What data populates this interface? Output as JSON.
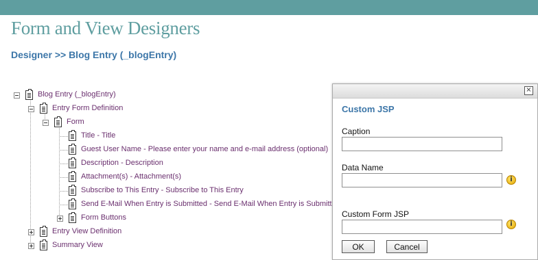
{
  "header": {
    "title": "Form and View Designers",
    "breadcrumb": {
      "designer": "Designer",
      "separator": ">>",
      "current": "Blog Entry (_blogEntry)"
    }
  },
  "tree": {
    "nodes": [
      {
        "label": "Blog Entry (_blogEntry)",
        "expanded": true
      },
      {
        "label": "Entry Form Definition",
        "expanded": true
      },
      {
        "label": "Form",
        "expanded": true
      },
      {
        "label": "Title - Title"
      },
      {
        "label": "Guest User Name - Please enter your name and e-mail address (optional)"
      },
      {
        "label": "Description - Description"
      },
      {
        "label": "Attachment(s) - Attachment(s)"
      },
      {
        "label": "Subscribe to This Entry - Subscribe to This Entry"
      },
      {
        "label": "Send E-Mail When Entry is Submitted - Send E-Mail When Entry is Submitted"
      },
      {
        "label": "Form Buttons",
        "expanded": false
      },
      {
        "label": "Entry View Definition",
        "expanded": false
      },
      {
        "label": "Summary View",
        "expanded": false
      }
    ]
  },
  "dialog": {
    "close_glyph": "×",
    "heading": "Custom JSP",
    "caption_label": "Caption",
    "caption_value": "",
    "data_name_label": "Data Name",
    "data_name_value": "",
    "custom_jsp_label": "Custom Form JSP",
    "custom_jsp_value": "",
    "info_glyph": "i",
    "ok_label": "OK",
    "cancel_label": "Cancel"
  },
  "colors": {
    "topbar": "#5f9ea0",
    "title": "#5f9ea0",
    "breadcrumb": "#3c76a8",
    "tree_link": "#6a2f6e",
    "dialog_heading": "#3c76a8"
  }
}
